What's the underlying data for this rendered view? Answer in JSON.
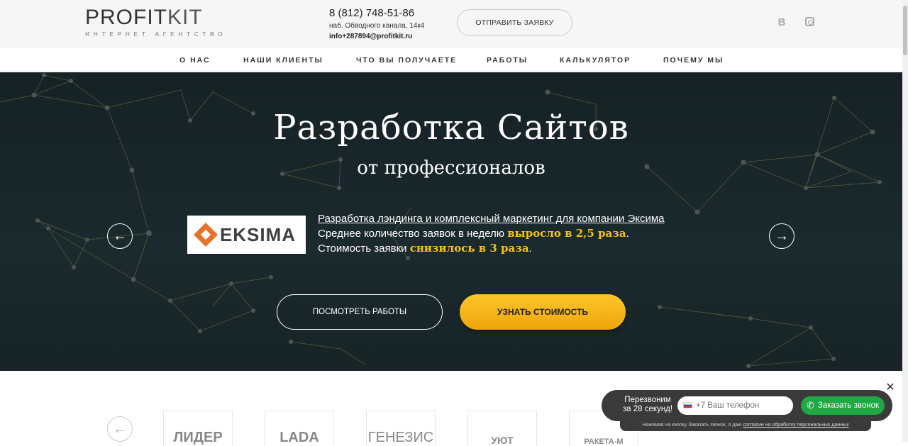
{
  "header": {
    "logo_main": "PROFIT",
    "logo_kit": "KIT",
    "logo_sub": "ИНТЕРНЕТ АГЕНТСТВО",
    "phone": "8 (812) 748-51-86",
    "address": "наб. Обводного канала, 14к4",
    "email": "info+287894@profitkit.ru",
    "send_button": "ОТПРАВИТЬ ЗАЯВКУ",
    "social": [
      "vk-icon",
      "instagram-icon"
    ],
    "vk_glyph": "B"
  },
  "nav": [
    "О НАС",
    "НАШИ КЛИЕНТЫ",
    "ЧТО ВЫ ПОЛУЧАЕТЕ",
    "РАБОТЫ",
    "КАЛЬКУЛЯТОР",
    "ПОЧЕМУ МЫ"
  ],
  "hero": {
    "title": "Разработка Сайтов",
    "subtitle": "от профессионалов",
    "case_logo": "EKSIMA",
    "case_link": "Разработка лэндинга и комплексный маркетинг для компании Эксима",
    "line2_prefix": "Среднее количество заявок в неделю ",
    "line2_highlight": "выросло в 2,5 раза",
    "line2_suffix": ".",
    "line3_prefix": "Стоимость заявки ",
    "line3_highlight": "снизилось в 3 раза",
    "line3_suffix": ".",
    "prev_arrow": "←",
    "next_arrow": "→",
    "btn_works": "ПОСМОТРЕТЬ РАБОТЫ",
    "btn_price": "УЗНАТЬ СТОИМОСТЬ"
  },
  "clients": {
    "prev_arrow": "←",
    "items": [
      "ЛИДЕР",
      "LADA",
      "ГЕНЕЗИС",
      "УЮТ",
      "РАКЕТА-М"
    ]
  },
  "callback": {
    "text": "Перезвоним за 28 секунд!",
    "placeholder": "+7 Ваш телефон",
    "button": "Заказать звонок",
    "note_prefix": "Нажимая на кнопку Заказать звонок, я даю ",
    "note_link": "согласие на обработку персональных данных",
    "close": "✕"
  },
  "colors": {
    "hero_bg": "#1b2a2d",
    "accent_yellow": "#f7c21c",
    "callback_green": "#1fa843",
    "widget_dark": "#3a3a3a"
  }
}
